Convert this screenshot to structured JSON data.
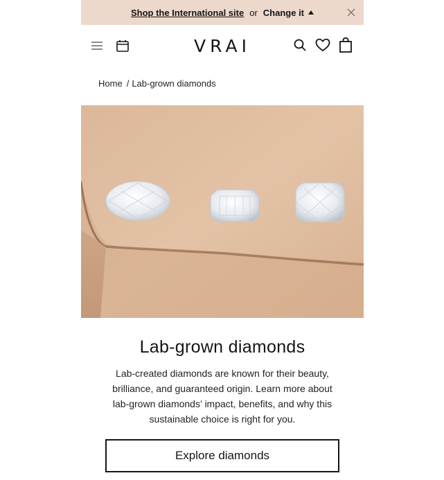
{
  "banner": {
    "link_label": "Shop the International site",
    "or_text": "or",
    "change_label": "Change it"
  },
  "header": {
    "logo": "VRAI",
    "icons": [
      "menu-icon",
      "calendar-icon",
      "search-icon",
      "heart-icon",
      "bag-icon"
    ]
  },
  "breadcrumb": {
    "items": [
      "Home",
      "Lab-grown diamonds"
    ],
    "separator": "/"
  },
  "main": {
    "title": "Lab-grown diamonds",
    "description": "Lab-created diamonds are known for their beauty, brilliance, and guaranteed origin. Learn more about lab-grown diamonds’ impact, benefits, and why this sustainable choice is right for you.",
    "cta_label": "Explore diamonds"
  },
  "colors": {
    "banner_bg": "#ecd9cc",
    "text": "#151515",
    "hero_sand": "#d9b799"
  }
}
